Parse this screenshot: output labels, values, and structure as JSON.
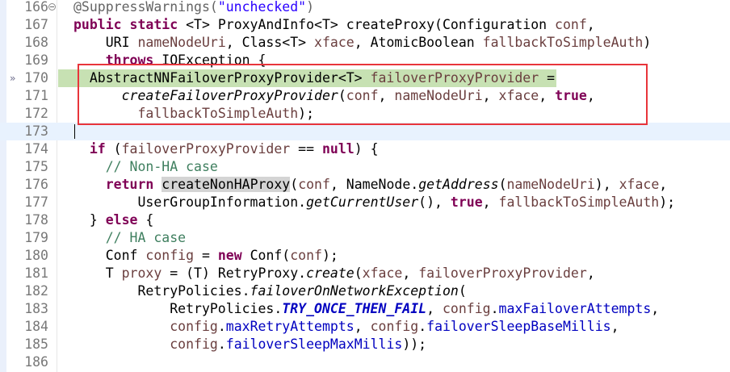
{
  "editor": {
    "lines": [
      {
        "num": "166",
        "fold": true,
        "tokens": [
          [
            "@SuppressWarnings(",
            "ann"
          ],
          [
            "\"unchecked\"",
            "str"
          ],
          [
            ")",
            "ann"
          ]
        ]
      },
      {
        "num": "167",
        "tokens": [
          [
            "public",
            "kw"
          ],
          [
            " ",
            "pl"
          ],
          [
            "static",
            "kw"
          ],
          [
            " <T> ProxyAndInfo<T> createProxy(Configuration ",
            "pl"
          ],
          [
            "conf",
            "var"
          ],
          [
            ",",
            "pl"
          ]
        ]
      },
      {
        "num": "168",
        "tokens": [
          [
            "    URI ",
            "pl"
          ],
          [
            "nameNodeUri",
            "var"
          ],
          [
            ", Class<T> ",
            "pl"
          ],
          [
            "xface",
            "var"
          ],
          [
            ", AtomicBoolean ",
            "pl"
          ],
          [
            "fallbackToSimpleAuth",
            "var"
          ],
          [
            ")",
            "pl"
          ]
        ]
      },
      {
        "num": "169",
        "tokens": [
          [
            "    ",
            "pl"
          ],
          [
            "throws",
            "kw"
          ],
          [
            " IOException {",
            "pl"
          ]
        ]
      },
      {
        "num": "170",
        "marker": "»",
        "highlight": true,
        "tokens": [
          [
            "  AbstractNNFailoverProxyProvider<T> ",
            "pl"
          ],
          [
            "failoverProxyProvider",
            "var"
          ],
          [
            " =",
            "pl"
          ]
        ]
      },
      {
        "num": "171",
        "tokens": [
          [
            "      ",
            "pl"
          ],
          [
            "createFailoverProxyProvider",
            "it"
          ],
          [
            "(",
            "pl"
          ],
          [
            "conf",
            "var"
          ],
          [
            ", ",
            "pl"
          ],
          [
            "nameNodeUri",
            "var"
          ],
          [
            ", ",
            "pl"
          ],
          [
            "xface",
            "var"
          ],
          [
            ", ",
            "pl"
          ],
          [
            "true",
            "kw"
          ],
          [
            ",",
            "pl"
          ]
        ]
      },
      {
        "num": "172",
        "tokens": [
          [
            "        ",
            "pl"
          ],
          [
            "fallbackToSimpleAuth",
            "var"
          ],
          [
            ");",
            "pl"
          ]
        ]
      },
      {
        "num": "173",
        "current": true,
        "caret": true,
        "tokens": []
      },
      {
        "num": "174",
        "tokens": [
          [
            "  ",
            "pl"
          ],
          [
            "if",
            "kw"
          ],
          [
            " (",
            "pl"
          ],
          [
            "failoverProxyProvider",
            "var"
          ],
          [
            " == ",
            "pl"
          ],
          [
            "null",
            "kw"
          ],
          [
            ") {",
            "pl"
          ]
        ]
      },
      {
        "num": "175",
        "tokens": [
          [
            "    ",
            "pl"
          ],
          [
            "// Non-HA case",
            "cm"
          ]
        ]
      },
      {
        "num": "176",
        "tokens": [
          [
            "    ",
            "pl"
          ],
          [
            "return",
            "kw"
          ],
          [
            " ",
            "pl"
          ],
          [
            "createNonHAProxy",
            "occ"
          ],
          [
            "(",
            "pl"
          ],
          [
            "conf",
            "var"
          ],
          [
            ", NameNode.",
            "pl"
          ],
          [
            "getAddress",
            "it"
          ],
          [
            "(",
            "pl"
          ],
          [
            "nameNodeUri",
            "var"
          ],
          [
            "), ",
            "pl"
          ],
          [
            "xface",
            "var"
          ],
          [
            ",",
            "pl"
          ]
        ]
      },
      {
        "num": "177",
        "tokens": [
          [
            "        UserGroupInformation.",
            "pl"
          ],
          [
            "getCurrentUser",
            "it"
          ],
          [
            "(), ",
            "pl"
          ],
          [
            "true",
            "kw"
          ],
          [
            ", ",
            "pl"
          ],
          [
            "fallbackToSimpleAuth",
            "var"
          ],
          [
            ");",
            "pl"
          ]
        ]
      },
      {
        "num": "178",
        "tokens": [
          [
            "  } ",
            "pl"
          ],
          [
            "else",
            "kw"
          ],
          [
            " {",
            "pl"
          ]
        ]
      },
      {
        "num": "179",
        "tokens": [
          [
            "    ",
            "pl"
          ],
          [
            "// HA case",
            "cm"
          ]
        ]
      },
      {
        "num": "180",
        "tokens": [
          [
            "    Conf ",
            "pl"
          ],
          [
            "config",
            "var"
          ],
          [
            " = ",
            "pl"
          ],
          [
            "new",
            "kw"
          ],
          [
            " Conf(",
            "pl"
          ],
          [
            "conf",
            "var"
          ],
          [
            ");",
            "pl"
          ]
        ]
      },
      {
        "num": "181",
        "tokens": [
          [
            "    T ",
            "pl"
          ],
          [
            "proxy",
            "var"
          ],
          [
            " = (T) RetryProxy.",
            "pl"
          ],
          [
            "create",
            "it"
          ],
          [
            "(",
            "pl"
          ],
          [
            "xface",
            "var"
          ],
          [
            ", ",
            "pl"
          ],
          [
            "failoverProxyProvider",
            "var"
          ],
          [
            ",",
            "pl"
          ]
        ]
      },
      {
        "num": "182",
        "tokens": [
          [
            "        RetryPolicies.",
            "pl"
          ],
          [
            "failoverOnNetworkException",
            "it"
          ],
          [
            "(",
            "pl"
          ]
        ]
      },
      {
        "num": "183",
        "tokens": [
          [
            "            RetryPolicies.",
            "pl"
          ],
          [
            "TRY_ONCE_THEN_FAIL",
            "sfld"
          ],
          [
            ", ",
            "pl"
          ],
          [
            "config",
            "var"
          ],
          [
            ".",
            "pl"
          ],
          [
            "maxFailoverAttempts",
            "fld"
          ],
          [
            ",",
            "pl"
          ]
        ]
      },
      {
        "num": "184",
        "tokens": [
          [
            "            ",
            "pl"
          ],
          [
            "config",
            "var"
          ],
          [
            ".",
            "pl"
          ],
          [
            "maxRetryAttempts",
            "fld"
          ],
          [
            ", ",
            "pl"
          ],
          [
            "config",
            "var"
          ],
          [
            ".",
            "pl"
          ],
          [
            "failoverSleepBaseMillis",
            "fld"
          ],
          [
            ",",
            "pl"
          ]
        ]
      },
      {
        "num": "185",
        "tokens": [
          [
            "            ",
            "pl"
          ],
          [
            "config",
            "var"
          ],
          [
            ".",
            "pl"
          ],
          [
            "failoverSleepMaxMillis",
            "fld"
          ],
          [
            "));",
            "pl"
          ]
        ]
      },
      {
        "num": "186",
        "tokens": []
      }
    ]
  }
}
